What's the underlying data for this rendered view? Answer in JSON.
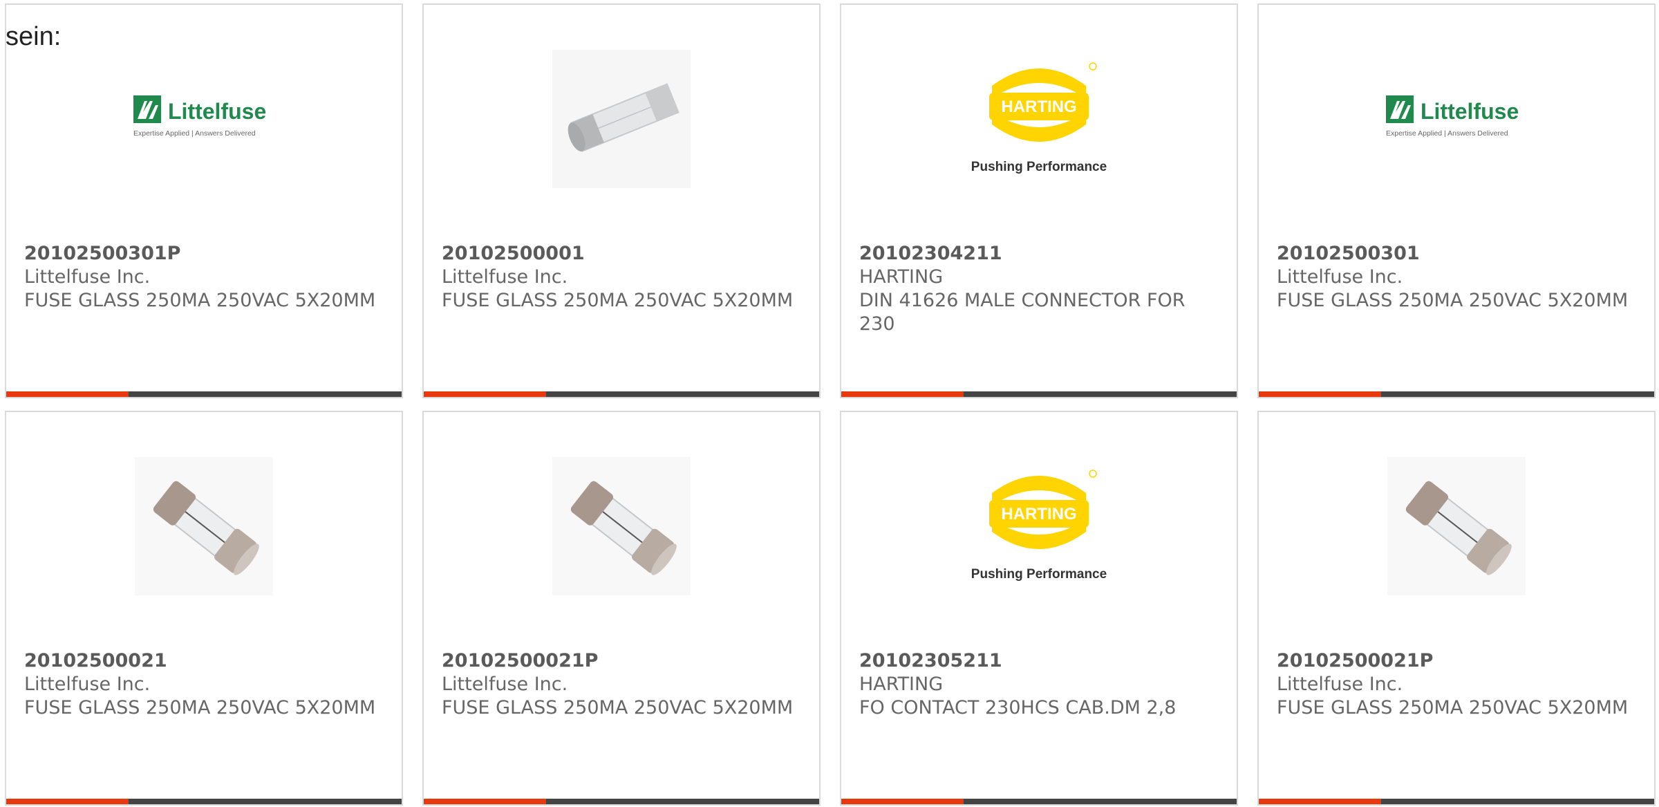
{
  "intro_text": "sein:",
  "colors": {
    "accent": "#e8380d",
    "bar": "#444444",
    "littelfuse_green": "#1f8a4c",
    "harting_yellow": "#ffd400"
  },
  "progress_fraction": 0.31,
  "products": [
    {
      "part_number": "20102500301P",
      "manufacturer": "Littelfuse Inc.",
      "description": "FUSE GLASS 250MA 250VAC 5X20MM",
      "image": "littelfuse-logo",
      "logo_text": "Littelfuse",
      "logo_tagline": "Expertise Applied | Answers Delivered"
    },
    {
      "part_number": "20102500001",
      "manufacturer": "Littelfuse Inc.",
      "description": "FUSE GLASS 250MA 250VAC 5X20MM",
      "image": "glass-fuse-photo"
    },
    {
      "part_number": "20102304211",
      "manufacturer": "HARTING",
      "description": "DIN 41626 MALE CONNECTOR FOR 230",
      "image": "harting-logo",
      "logo_text": "HARTING",
      "logo_tagline": "Pushing Performance"
    },
    {
      "part_number": "20102500301",
      "manufacturer": "Littelfuse Inc.",
      "description": "FUSE GLASS 250MA 250VAC 5X20MM",
      "image": "littelfuse-logo",
      "logo_text": "Littelfuse",
      "logo_tagline": "Expertise Applied | Answers Delivered"
    },
    {
      "part_number": "20102500021",
      "manufacturer": "Littelfuse Inc.",
      "description": "FUSE GLASS 250MA 250VAC 5X20MM",
      "image": "metal-cap-fuse-photo"
    },
    {
      "part_number": "20102500021P",
      "manufacturer": "Littelfuse Inc.",
      "description": "FUSE GLASS 250MA 250VAC 5X20MM",
      "image": "metal-cap-fuse-photo"
    },
    {
      "part_number": "20102305211",
      "manufacturer": "HARTING",
      "description": "FO CONTACT 230HCS CAB.DM 2,8",
      "image": "harting-logo",
      "logo_text": "HARTING",
      "logo_tagline": "Pushing Performance"
    },
    {
      "part_number": "20102500021P",
      "manufacturer": "Littelfuse Inc.",
      "description": "FUSE GLASS 250MA 250VAC 5X20MM",
      "image": "metal-cap-fuse-photo"
    }
  ]
}
